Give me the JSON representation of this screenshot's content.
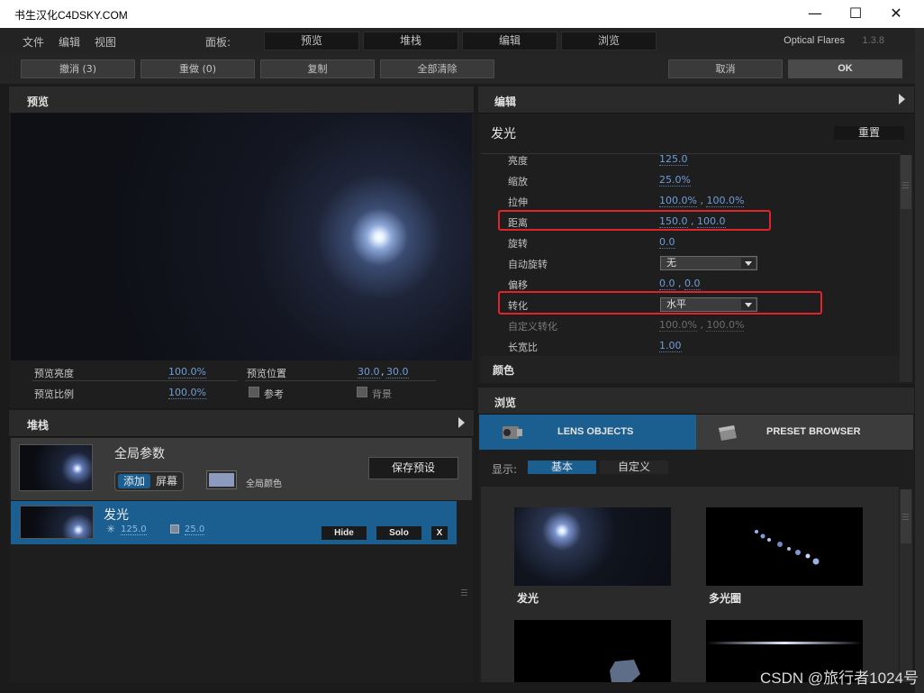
{
  "window": {
    "title": "书生汉化C4DSKY.COM",
    "minimize_glyph": "—",
    "maximize_glyph": "☐",
    "close_glyph": "✕"
  },
  "menu": {
    "items": [
      "文件",
      "编辑",
      "视图"
    ],
    "panel_label": "面板:",
    "panel_tabs": [
      "预览",
      "堆栈",
      "编辑",
      "浏览"
    ],
    "app_name": "Optical Flares",
    "version": "1.3.8"
  },
  "toolbar": {
    "undo": "撤消 (3)",
    "redo": "重做 (0)",
    "copy": "复制",
    "clear_all": "全部清除",
    "cancel": "取消",
    "ok": "OK"
  },
  "preview": {
    "title": "预览",
    "brightness_label": "预览亮度",
    "brightness_value": "100.0%",
    "position_label": "预览位置",
    "position_x": "30.0",
    "position_y": "30.0",
    "scale_label": "预览比例",
    "scale_value": "100.0%",
    "reference_label": "参考",
    "background_label": "背景"
  },
  "stack": {
    "title": "堆栈",
    "global_title": "全局参数",
    "blend_add": "添加",
    "blend_screen": "屏幕",
    "global_color_label": "全局颜色",
    "save_preset": "保存预设",
    "glow_item": {
      "name": "发光",
      "brightness": "125.0",
      "scale": "25.0",
      "hide": "Hide",
      "solo": "Solo",
      "close": "X"
    }
  },
  "edit": {
    "title": "编辑",
    "object_name": "发光",
    "reset": "重置",
    "rows": [
      {
        "label": "亮度",
        "value": "125.0"
      },
      {
        "label": "缩放",
        "value": "25.0%"
      },
      {
        "label": "拉伸",
        "v1": "100.0%",
        "v2": "100.0%"
      },
      {
        "label": "距离",
        "v1": "150.0",
        "v2": "100.0"
      },
      {
        "label": "旋转",
        "value": "0.0"
      },
      {
        "label": "自动旋转",
        "dropdown": "无"
      },
      {
        "label": "偏移",
        "v1": "0.0",
        "v2": "0.0"
      },
      {
        "label": "转化",
        "dropdown": "水平"
      },
      {
        "label": "自定义转化",
        "v1": "100.0%",
        "v2": "100.0%"
      },
      {
        "label": "长宽比",
        "value": "1.00"
      }
    ],
    "color_section": "颜色"
  },
  "browse": {
    "title": "浏览",
    "tab_lens": "LENS OBJECTS",
    "tab_preset": "PRESET BROWSER",
    "display_label": "显示:",
    "filter_basic": "基本",
    "filter_custom": "自定义",
    "items": [
      "发光",
      "多光圈"
    ]
  },
  "colors": {
    "accent": "#1b5f91",
    "highlight_box": "#e0242a",
    "value_blue": "#6f9ed8"
  },
  "watermark": "CSDN @旅行者1024号"
}
